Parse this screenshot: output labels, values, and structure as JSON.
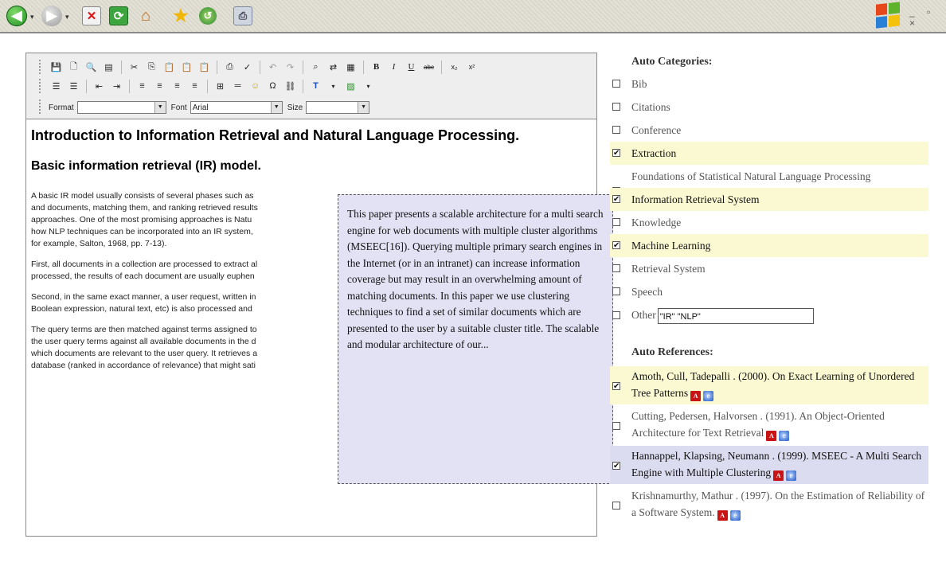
{
  "browser": {
    "window_controls": "_ ▫ ×"
  },
  "editor": {
    "format_label": "Format",
    "font_label": "Font",
    "font_value": "Arial",
    "size_label": "Size",
    "title": "Introduction to Information Retrieval and Natural Language Processing.",
    "subtitle": "Basic information retrieval (IR) model.",
    "paragraphs": [
      "A basic IR model usually consists of several phases such as\nand documents, matching them, and ranking retrieved results\napproaches. One of the most promising approaches is Natu\nhow NLP techniques can be incorporated into an IR system,\nfor example, Salton, 1968, pp. 7-13).",
      "First, all documents in a collection are processed to extract al\nprocessed, the results of each document are usually euphen",
      "Second, in the same exact manner, a user request, written in\nBoolean expression, natural text, etc) is also processed and",
      "The query terms are then matched against terms assigned to\nthe user query terms against all available documents in the d\nwhich documents are relevant to the user query. It retrieves a\ndatabase (ranked in accordance of relevance) that might sati"
    ]
  },
  "popup": {
    "text": "This paper presents a scalable architecture for a multi search engine for web documents with multiple cluster algorithms (MSEEC[16]). Querying multiple primary search engines in the Internet (or in an intranet) can increase information coverage but may result in an overwhelming amount of matching documents. In this paper we use clustering techniques to find a set of similar documents which are presented to the user by a suitable cluster title. The scalable and modular architecture of our..."
  },
  "categories": {
    "heading": "Auto Categories:",
    "items": [
      {
        "label": "Bib",
        "checked": false
      },
      {
        "label": "Citations",
        "checked": false
      },
      {
        "label": "Conference",
        "checked": false
      },
      {
        "label": "Extraction",
        "checked": true
      },
      {
        "label": "Foundations of Statistical Natural Language Processing",
        "checked": false
      },
      {
        "label": "Information Retrieval System",
        "checked": true
      },
      {
        "label": "Knowledge",
        "checked": false
      },
      {
        "label": "Machine Learning",
        "checked": true
      },
      {
        "label": "Retrieval System",
        "checked": false
      },
      {
        "label": "Speech",
        "checked": false
      }
    ],
    "other_label": "Other",
    "other_value": "\"IR\" \"NLP\""
  },
  "references": {
    "heading": "Auto References:",
    "items": [
      {
        "text": "Amoth, Cull, Tadepalli . (2000). On Exact Learning of Unordered Tree Patterns",
        "checked": true
      },
      {
        "text": "Cutting, Pedersen, Halvorsen . (1991). An Object-Oriented Architecture for Text Retrieval",
        "checked": false
      },
      {
        "text": "Hannappel, Klapsing, Neumann . (1999). MSEEC - A Multi Search Engine with Multiple Clustering",
        "checked": true
      },
      {
        "text": "Krishnamurthy, Mathur . (1997). On the Estimation of Reliability of a Software System.",
        "checked": false
      }
    ]
  }
}
